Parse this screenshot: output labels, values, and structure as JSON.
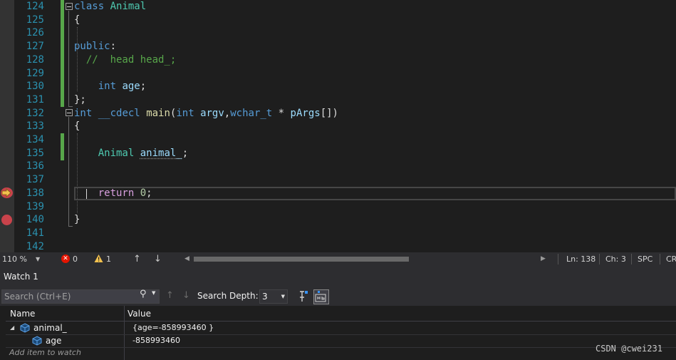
{
  "editor": {
    "lines": [
      {
        "n": "124",
        "tokens": [
          {
            "c": "kw",
            "t": "class"
          },
          {
            "c": "pl",
            "t": " "
          },
          {
            "c": "ty",
            "t": "Animal"
          }
        ]
      },
      {
        "n": "125",
        "tokens": [
          {
            "c": "pl",
            "t": "{"
          }
        ]
      },
      {
        "n": "126",
        "tokens": []
      },
      {
        "n": "127",
        "tokens": [
          {
            "c": "kw",
            "t": "public"
          },
          {
            "c": "pl",
            "t": ":"
          }
        ]
      },
      {
        "n": "128",
        "tokens": [
          {
            "c": "cm",
            "t": "  //  head head_;"
          }
        ]
      },
      {
        "n": "129",
        "tokens": []
      },
      {
        "n": "130",
        "tokens": [
          {
            "c": "pl",
            "t": "    "
          },
          {
            "c": "kw",
            "t": "int"
          },
          {
            "c": "pl",
            "t": " "
          },
          {
            "c": "id",
            "t": "age"
          },
          {
            "c": "pl",
            "t": ";"
          }
        ]
      },
      {
        "n": "131",
        "tokens": [
          {
            "c": "pl",
            "t": "};"
          }
        ]
      },
      {
        "n": "132",
        "tokens": [
          {
            "c": "kw",
            "t": "int"
          },
          {
            "c": "pl",
            "t": " "
          },
          {
            "c": "kw",
            "t": "__cdecl"
          },
          {
            "c": "pl",
            "t": " "
          },
          {
            "c": "fn",
            "t": "main"
          },
          {
            "c": "pl",
            "t": "("
          },
          {
            "c": "kw",
            "t": "int"
          },
          {
            "c": "pl",
            "t": " "
          },
          {
            "c": "id",
            "t": "argv"
          },
          {
            "c": "pl",
            "t": ","
          },
          {
            "c": "kw",
            "t": "wchar_t"
          },
          {
            "c": "pl",
            "t": " * "
          },
          {
            "c": "id",
            "t": "pArgs"
          },
          {
            "c": "pl",
            "t": "[])"
          }
        ]
      },
      {
        "n": "133",
        "tokens": [
          {
            "c": "pl",
            "t": "{"
          }
        ]
      },
      {
        "n": "134",
        "tokens": []
      },
      {
        "n": "135",
        "tokens": [
          {
            "c": "pl",
            "t": "    "
          },
          {
            "c": "ty",
            "t": "Animal"
          },
          {
            "c": "pl",
            "t": " "
          },
          {
            "c": "id squig",
            "t": "animal_"
          },
          {
            "c": "pl",
            "t": ";"
          }
        ]
      },
      {
        "n": "136",
        "tokens": []
      },
      {
        "n": "137",
        "tokens": []
      },
      {
        "n": "138",
        "tokens": [
          {
            "c": "pl",
            "t": "    "
          },
          {
            "c": "ctl",
            "t": "return"
          },
          {
            "c": "pl",
            "t": " "
          },
          {
            "c": "num",
            "t": "0"
          },
          {
            "c": "pl",
            "t": ";"
          }
        ]
      },
      {
        "n": "139",
        "tokens": []
      },
      {
        "n": "140",
        "tokens": [
          {
            "c": "pl",
            "t": "}"
          }
        ]
      },
      {
        "n": "141",
        "tokens": []
      },
      {
        "n": "142",
        "tokens": []
      }
    ]
  },
  "status": {
    "zoom": "110 %",
    "errors": "0",
    "warnings": "1",
    "line": "Ln: 138",
    "col": "Ch: 3",
    "spacing": "SPC",
    "line_ending": "CR"
  },
  "watch": {
    "title": "Watch 1",
    "search_placeholder": "Search (Ctrl+E)",
    "search_depth_label": "Search Depth:",
    "search_depth_value": "3",
    "columns": {
      "name": "Name",
      "value": "Value"
    },
    "rows": [
      {
        "name": "animal_",
        "value": "{age=-858993460 }"
      },
      {
        "name": "age",
        "value": "-858993460"
      }
    ],
    "add_item": "Add item to watch"
  },
  "watermark": "CSDN @cwei231",
  "colors": {
    "keyword": "#569cd6",
    "type": "#4ec9b0",
    "identifier": "#9cdcfe",
    "comment": "#57a64a",
    "control": "#d8a0df",
    "line_number": "#2b91af",
    "breakpoint": "#c9434b"
  }
}
